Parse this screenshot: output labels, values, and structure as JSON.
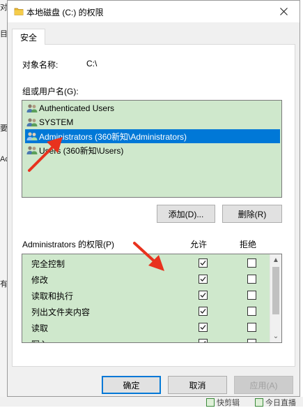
{
  "window": {
    "title": "本地磁盘 (C:) 的权限",
    "tab": "安全",
    "object_name_label": "对象名称:",
    "object_name_value": "C:\\",
    "groups_label": "组或用户名(G):",
    "users": [
      {
        "name": "Authenticated Users",
        "selected": false
      },
      {
        "name": "SYSTEM",
        "selected": false
      },
      {
        "name": "Administrators (360新知\\Administrators)",
        "selected": true
      },
      {
        "name": "Users (360新知\\Users)",
        "selected": false
      }
    ],
    "add_button": "添加(D)...",
    "remove_button": "删除(R)",
    "permissions_label": "Administrators 的权限(P)",
    "allow_header": "允许",
    "deny_header": "拒绝",
    "permissions": [
      {
        "name": "完全控制",
        "allow": true,
        "deny": false
      },
      {
        "name": "修改",
        "allow": true,
        "deny": false
      },
      {
        "name": "读取和执行",
        "allow": true,
        "deny": false
      },
      {
        "name": "列出文件夹内容",
        "allow": true,
        "deny": false
      },
      {
        "name": "读取",
        "allow": true,
        "deny": false
      },
      {
        "name": "写入",
        "allow": true,
        "deny": false
      }
    ],
    "ok_button": "确定",
    "cancel_button": "取消",
    "apply_button": "应用(A)"
  },
  "background": {
    "left_chars": [
      "对",
      "",
      "目",
      "",
      "",
      "",
      "",
      "",
      "要",
      "",
      "Ac",
      "",
      "",
      "",
      "",
      "",
      "",
      "",
      "有",
      "",
      ""
    ],
    "bottom_items": [
      "快剪辑",
      "今日直播"
    ]
  },
  "colors": {
    "list_background": "#cfe8cc",
    "selection": "#0078d7",
    "arrow": "#e8321e"
  },
  "icons": [
    "folder-icon",
    "close-icon",
    "users-icon",
    "checkmark-icon",
    "scroll-up-icon",
    "scroll-down-icon"
  ]
}
